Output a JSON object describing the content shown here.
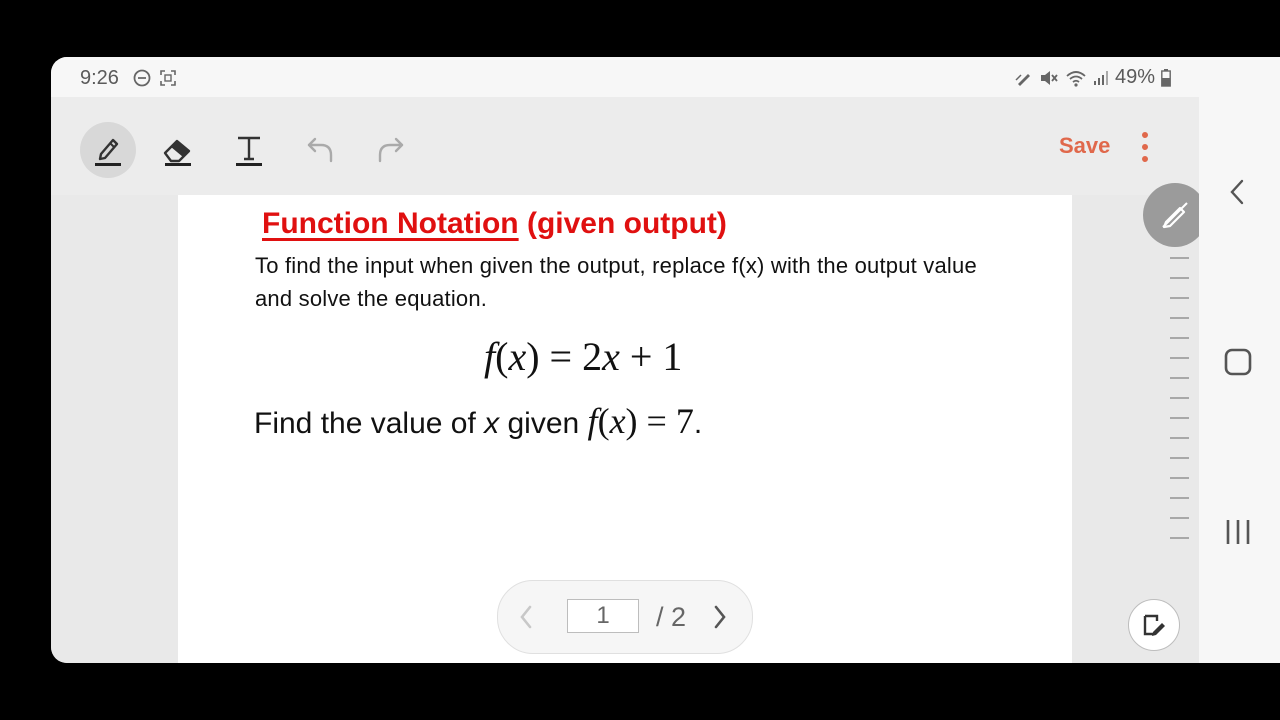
{
  "status": {
    "time": "9:26",
    "battery": "49%"
  },
  "toolbar": {
    "save_label": "Save"
  },
  "document": {
    "title_underlined": "Function Notation",
    "title_rest": " (given output)",
    "paragraph": "To find the input when given the output,  replace f(x) with the output value and solve the equation.",
    "equation1": {
      "f": "f",
      "lp": "(",
      "x": "x",
      "rp": ")",
      "rest": " = 2",
      "x2": "x",
      "rest2": " + 1"
    },
    "find_text": "Find the value of ",
    "find_var": "x",
    "find_text2": " given ",
    "equation2": {
      "f": "f",
      "lp": "(",
      "x": "x",
      "rp": ")",
      "rest": " = 7"
    },
    "find_end": "."
  },
  "pager": {
    "current_page": "1",
    "total": "/ 2"
  },
  "icons": {
    "pen": "pen-icon",
    "eraser": "eraser-icon",
    "text": "text-icon",
    "undo": "undo-icon",
    "redo": "redo-icon",
    "more": "more-vertical-icon"
  },
  "colors": {
    "accent": "#e0684b",
    "title_red": "#e01010"
  }
}
